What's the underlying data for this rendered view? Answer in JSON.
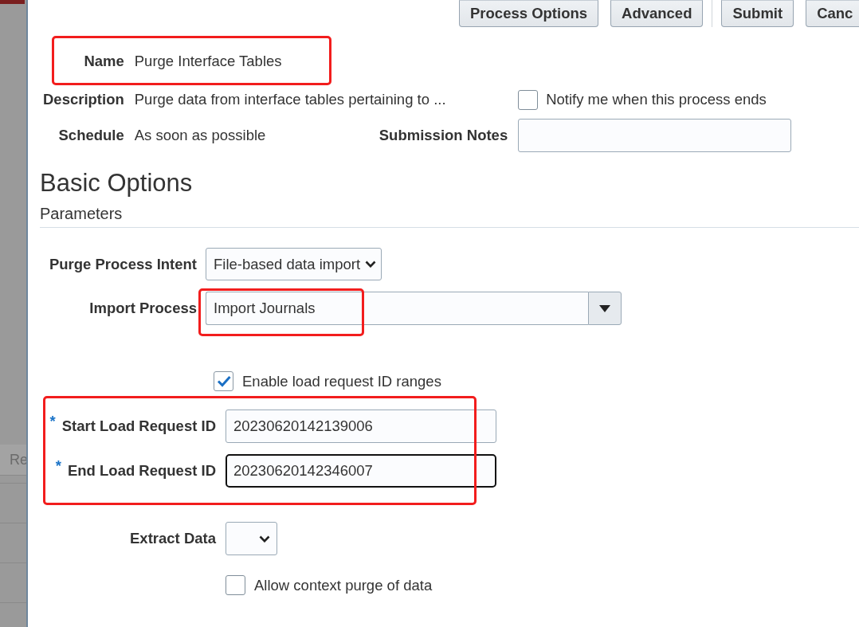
{
  "background_page": {
    "tab": "Re"
  },
  "toolbar": {
    "groups": [
      [
        "Process Options",
        "Advanced"
      ],
      [
        "Submit",
        "Canc"
      ]
    ]
  },
  "header": {
    "name": {
      "label": "Name",
      "value": "Purge Interface Tables",
      "highlighted": true
    },
    "description": {
      "label": "Description",
      "value": "Purge data from interface tables pertaining to ..."
    },
    "schedule": {
      "label": "Schedule",
      "value": "As soon as possible"
    },
    "notify": {
      "label": "Notify me when this process ends",
      "checked": false
    },
    "submission_notes": {
      "label": "Submission Notes"
    }
  },
  "section": {
    "title": "Basic Options",
    "subtitle": "Parameters"
  },
  "parameter_groups": [
    {
      "rows": [
        {
          "kind": "select",
          "label": "Purge Process Intent",
          "value": "File-based data import",
          "highlighted": false
        },
        {
          "kind": "combobox",
          "label": "Import Process",
          "value": "Import Journals",
          "highlighted": true
        },
        {
          "kind": "checkbox",
          "label": "Enable load request ID ranges",
          "checked": true,
          "highlighted": false
        }
      ]
    },
    {
      "rows": [
        {
          "kind": "range",
          "highlighted": true,
          "fields": [
            {
              "marker": "*",
              "label": "Start Load Request ID",
              "value": "20230620142139006",
              "focused": false
            },
            {
              "marker": "*",
              "label": "End Load Request ID",
              "value": "20230620142346007",
              "focused": true
            }
          ]
        },
        {
          "kind": "select",
          "label": "Extract Data",
          "highlighted": false
        },
        {
          "kind": "checkbox",
          "label": "Allow context purge of data",
          "checked": false,
          "highlighted": false
        }
      ]
    }
  ]
}
